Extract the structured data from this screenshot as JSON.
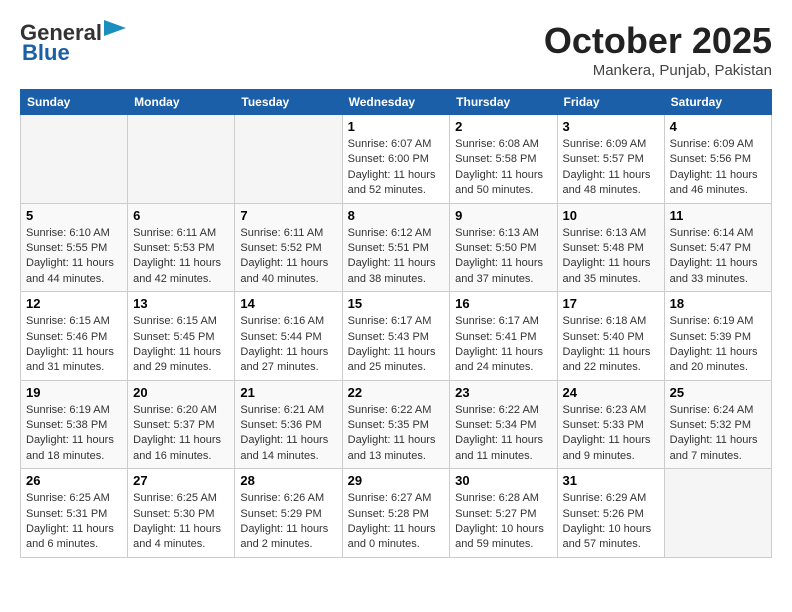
{
  "header": {
    "logo_general": "General",
    "logo_blue": "Blue",
    "month": "October 2025",
    "location": "Mankera, Punjab, Pakistan"
  },
  "weekdays": [
    "Sunday",
    "Monday",
    "Tuesday",
    "Wednesday",
    "Thursday",
    "Friday",
    "Saturday"
  ],
  "weeks": [
    [
      {
        "day": "",
        "info": ""
      },
      {
        "day": "",
        "info": ""
      },
      {
        "day": "",
        "info": ""
      },
      {
        "day": "1",
        "info": "Sunrise: 6:07 AM\nSunset: 6:00 PM\nDaylight: 11 hours\nand 52 minutes."
      },
      {
        "day": "2",
        "info": "Sunrise: 6:08 AM\nSunset: 5:58 PM\nDaylight: 11 hours\nand 50 minutes."
      },
      {
        "day": "3",
        "info": "Sunrise: 6:09 AM\nSunset: 5:57 PM\nDaylight: 11 hours\nand 48 minutes."
      },
      {
        "day": "4",
        "info": "Sunrise: 6:09 AM\nSunset: 5:56 PM\nDaylight: 11 hours\nand 46 minutes."
      }
    ],
    [
      {
        "day": "5",
        "info": "Sunrise: 6:10 AM\nSunset: 5:55 PM\nDaylight: 11 hours\nand 44 minutes."
      },
      {
        "day": "6",
        "info": "Sunrise: 6:11 AM\nSunset: 5:53 PM\nDaylight: 11 hours\nand 42 minutes."
      },
      {
        "day": "7",
        "info": "Sunrise: 6:11 AM\nSunset: 5:52 PM\nDaylight: 11 hours\nand 40 minutes."
      },
      {
        "day": "8",
        "info": "Sunrise: 6:12 AM\nSunset: 5:51 PM\nDaylight: 11 hours\nand 38 minutes."
      },
      {
        "day": "9",
        "info": "Sunrise: 6:13 AM\nSunset: 5:50 PM\nDaylight: 11 hours\nand 37 minutes."
      },
      {
        "day": "10",
        "info": "Sunrise: 6:13 AM\nSunset: 5:48 PM\nDaylight: 11 hours\nand 35 minutes."
      },
      {
        "day": "11",
        "info": "Sunrise: 6:14 AM\nSunset: 5:47 PM\nDaylight: 11 hours\nand 33 minutes."
      }
    ],
    [
      {
        "day": "12",
        "info": "Sunrise: 6:15 AM\nSunset: 5:46 PM\nDaylight: 11 hours\nand 31 minutes."
      },
      {
        "day": "13",
        "info": "Sunrise: 6:15 AM\nSunset: 5:45 PM\nDaylight: 11 hours\nand 29 minutes."
      },
      {
        "day": "14",
        "info": "Sunrise: 6:16 AM\nSunset: 5:44 PM\nDaylight: 11 hours\nand 27 minutes."
      },
      {
        "day": "15",
        "info": "Sunrise: 6:17 AM\nSunset: 5:43 PM\nDaylight: 11 hours\nand 25 minutes."
      },
      {
        "day": "16",
        "info": "Sunrise: 6:17 AM\nSunset: 5:41 PM\nDaylight: 11 hours\nand 24 minutes."
      },
      {
        "day": "17",
        "info": "Sunrise: 6:18 AM\nSunset: 5:40 PM\nDaylight: 11 hours\nand 22 minutes."
      },
      {
        "day": "18",
        "info": "Sunrise: 6:19 AM\nSunset: 5:39 PM\nDaylight: 11 hours\nand 20 minutes."
      }
    ],
    [
      {
        "day": "19",
        "info": "Sunrise: 6:19 AM\nSunset: 5:38 PM\nDaylight: 11 hours\nand 18 minutes."
      },
      {
        "day": "20",
        "info": "Sunrise: 6:20 AM\nSunset: 5:37 PM\nDaylight: 11 hours\nand 16 minutes."
      },
      {
        "day": "21",
        "info": "Sunrise: 6:21 AM\nSunset: 5:36 PM\nDaylight: 11 hours\nand 14 minutes."
      },
      {
        "day": "22",
        "info": "Sunrise: 6:22 AM\nSunset: 5:35 PM\nDaylight: 11 hours\nand 13 minutes."
      },
      {
        "day": "23",
        "info": "Sunrise: 6:22 AM\nSunset: 5:34 PM\nDaylight: 11 hours\nand 11 minutes."
      },
      {
        "day": "24",
        "info": "Sunrise: 6:23 AM\nSunset: 5:33 PM\nDaylight: 11 hours\nand 9 minutes."
      },
      {
        "day": "25",
        "info": "Sunrise: 6:24 AM\nSunset: 5:32 PM\nDaylight: 11 hours\nand 7 minutes."
      }
    ],
    [
      {
        "day": "26",
        "info": "Sunrise: 6:25 AM\nSunset: 5:31 PM\nDaylight: 11 hours\nand 6 minutes."
      },
      {
        "day": "27",
        "info": "Sunrise: 6:25 AM\nSunset: 5:30 PM\nDaylight: 11 hours\nand 4 minutes."
      },
      {
        "day": "28",
        "info": "Sunrise: 6:26 AM\nSunset: 5:29 PM\nDaylight: 11 hours\nand 2 minutes."
      },
      {
        "day": "29",
        "info": "Sunrise: 6:27 AM\nSunset: 5:28 PM\nDaylight: 11 hours\nand 0 minutes."
      },
      {
        "day": "30",
        "info": "Sunrise: 6:28 AM\nSunset: 5:27 PM\nDaylight: 10 hours\nand 59 minutes."
      },
      {
        "day": "31",
        "info": "Sunrise: 6:29 AM\nSunset: 5:26 PM\nDaylight: 10 hours\nand 57 minutes."
      },
      {
        "day": "",
        "info": ""
      }
    ]
  ]
}
